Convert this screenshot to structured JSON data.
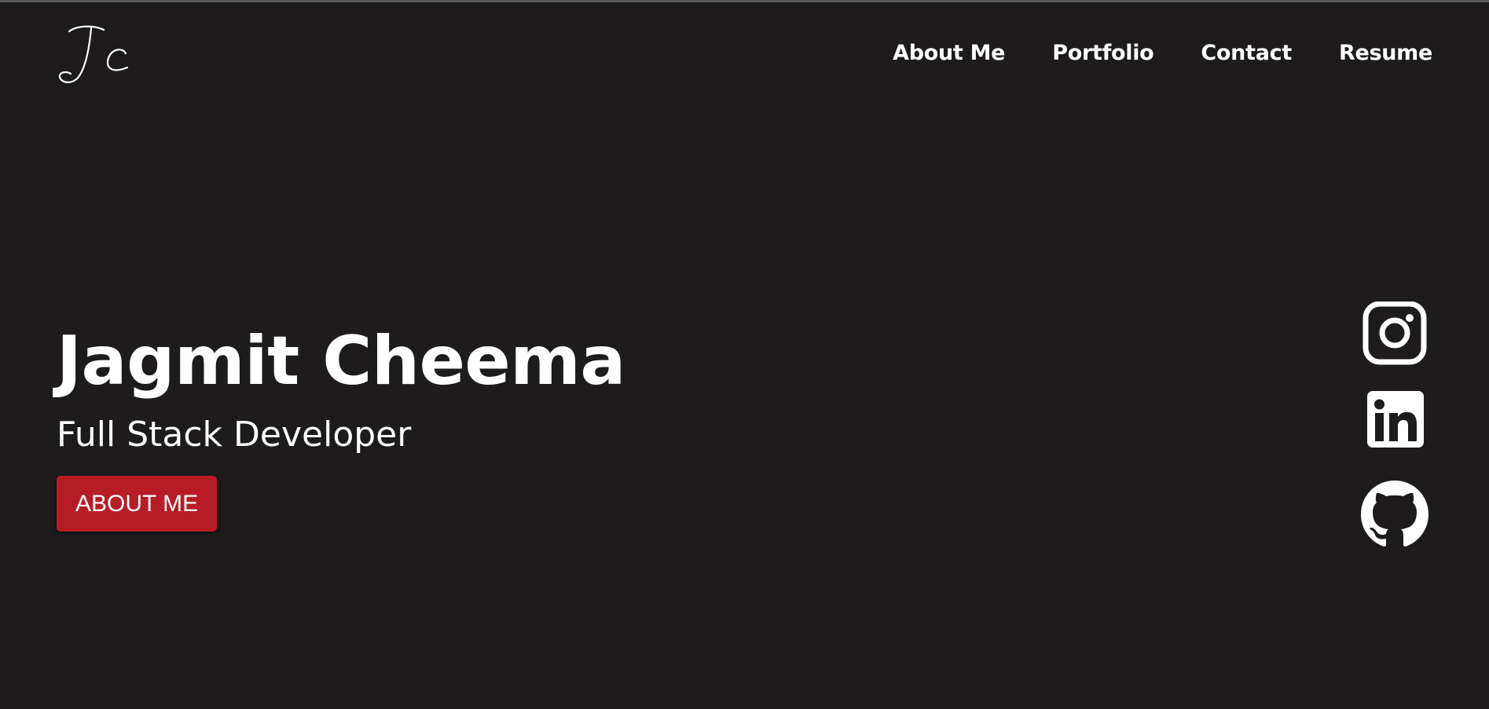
{
  "logo": {
    "text": "Jc",
    "icon": "signature-logo"
  },
  "nav": {
    "items": [
      {
        "label": "About Me"
      },
      {
        "label": "Portfolio"
      },
      {
        "label": "Contact"
      },
      {
        "label": "Resume"
      }
    ]
  },
  "hero": {
    "name": "Jagmit Cheema",
    "role": "Full Stack Developer",
    "button_label": "ABOUT ME"
  },
  "social": {
    "icons": [
      "instagram-icon",
      "linkedin-icon",
      "github-icon"
    ]
  },
  "colors": {
    "background": "#1d1b1c",
    "accent": "#b71c24",
    "text": "#ffffff"
  }
}
